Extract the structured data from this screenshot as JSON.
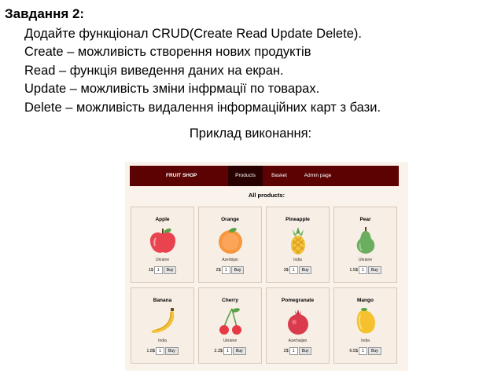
{
  "task": {
    "title": "Завдання 2:",
    "lines": [
      "Додайте функціонал CRUD(Create Read Update Delete).",
      "Create – можливість створення нових продуктів",
      "Read – функція виведення даних на екран.",
      "Update – можливість зміни інфрмації по товарах.",
      "Delete – можливість видалення інформаційних карт з бази."
    ],
    "example_caption": "Приклад виконання:"
  },
  "shop": {
    "brand": "FRUIT SHOP",
    "nav": [
      "Products",
      "Basket",
      "Admin page"
    ],
    "active_nav": "Products",
    "heading": "All products:",
    "buy_label": "Buy",
    "quantity_default": "1",
    "products": [
      {
        "name": "Apple",
        "origin": "Ukraine",
        "price": "1$",
        "icon": "apple-icon"
      },
      {
        "name": "Orange",
        "origin": "Azerbijan",
        "price": "2$",
        "icon": "orange-icon"
      },
      {
        "name": "Pineapple",
        "origin": "India",
        "price": "3$",
        "icon": "pineapple-icon"
      },
      {
        "name": "Pear",
        "origin": "Ukraine",
        "price": "1.5$",
        "icon": "pear-icon"
      },
      {
        "name": "Banana",
        "origin": "India",
        "price": "1.8$",
        "icon": "banana-icon"
      },
      {
        "name": "Cherry",
        "origin": "Ukraine",
        "price": "2.3$",
        "icon": "cherry-icon"
      },
      {
        "name": "Pomegranate",
        "origin": "Azerbaijan",
        "price": "2$",
        "icon": "pomegranate-icon"
      },
      {
        "name": "Mango",
        "origin": "India",
        "price": "6.5$",
        "icon": "mango-icon"
      }
    ],
    "colors": {
      "navbar": "#5c0202",
      "background": "#faf3ec"
    }
  }
}
